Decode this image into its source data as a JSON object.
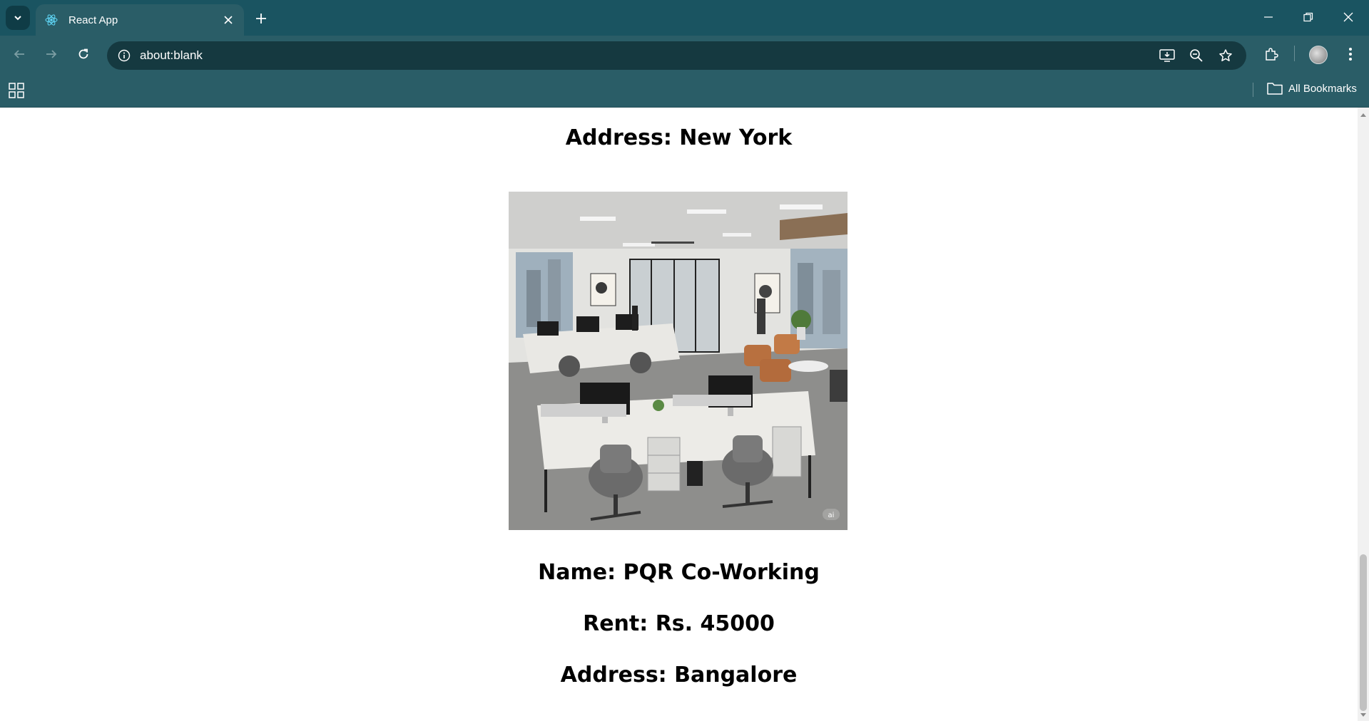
{
  "browser": {
    "tab_title": "React App",
    "url": "about:blank",
    "bookmarks_label": "All Bookmarks"
  },
  "content": {
    "prev_address": "Address: New York",
    "listing": {
      "image_alt": "Open-plan co-working office with desks, monitors and lounge chairs",
      "image_badge": "ai",
      "name": "Name: PQR Co-Working",
      "rent": "Rent: Rs. 45000",
      "address": "Address: Bangalore"
    }
  },
  "colors": {
    "tabstrip": "#1a5461",
    "toolbar": "#2a5d67",
    "omnibox": "#153940"
  },
  "scroll": {
    "position_fraction": 0.95
  }
}
